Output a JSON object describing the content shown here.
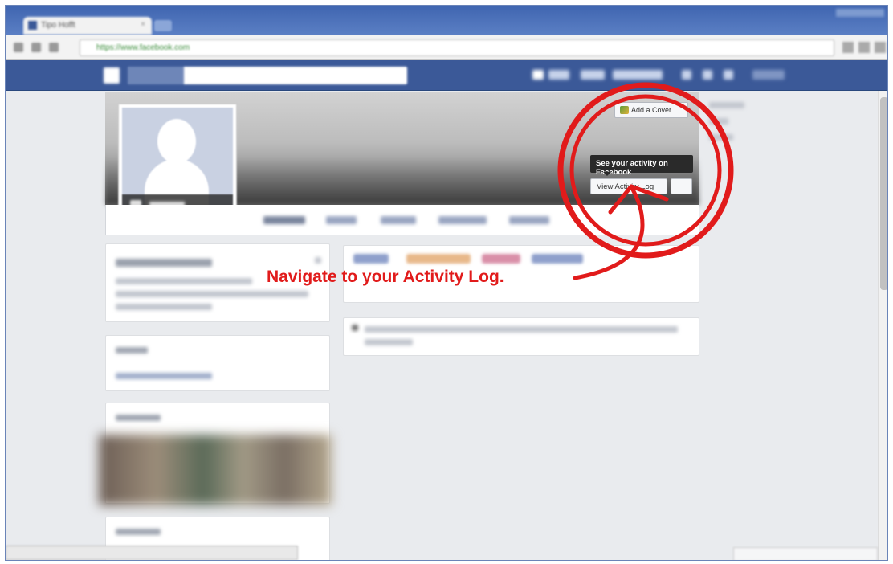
{
  "browser": {
    "tab_title": "Tipo Hofft",
    "url": "https://www.facebook.com"
  },
  "cover": {
    "add_cover_label": "Add a Cover",
    "tooltip": "See your activity on Facebook",
    "activity_log_label": "View Activity Log",
    "more_label": "···"
  },
  "annotation": {
    "text": "Navigate to your Activity Log.",
    "color": "#e11b1b"
  },
  "colors": {
    "facebook_blue": "#3b5998",
    "page_bg": "#e9ebee"
  }
}
